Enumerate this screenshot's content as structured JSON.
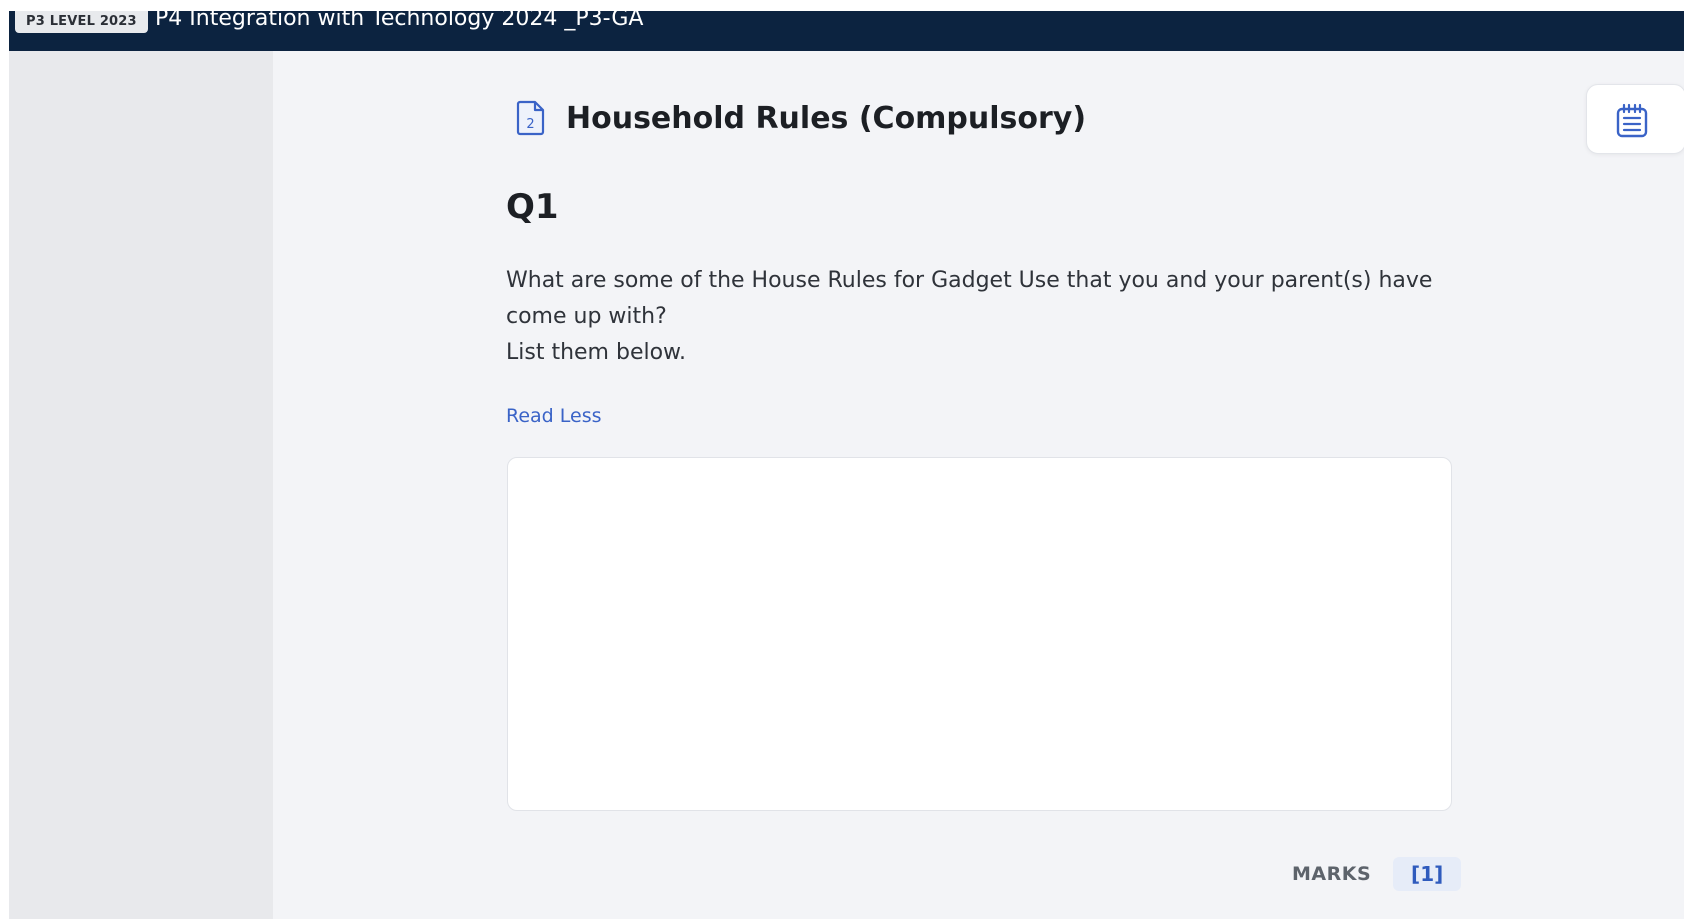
{
  "header": {
    "level_badge": "P3 LEVEL 2023",
    "course_title": "P4 Integration with Technology 2024 _P3-GA"
  },
  "section": {
    "icon": "document-page-2-icon",
    "page_number": "2",
    "title": "Household Rules (Compulsory)"
  },
  "question": {
    "number": "Q1",
    "text_line1": "What are some of the House Rules for Gadget Use that you and your parent(s) have come up with?",
    "text_line2": "List them below.",
    "read_less": "Read Less",
    "answer_value": ""
  },
  "marks": {
    "label": "MARKS",
    "value": "[1]"
  },
  "side_button": {
    "icon": "notepad-icon"
  },
  "colors": {
    "header_bg": "#0c2340",
    "accent": "#3a63c7",
    "page_bg": "#f3f4f7",
    "sidebar_bg": "#e8e9ec"
  }
}
